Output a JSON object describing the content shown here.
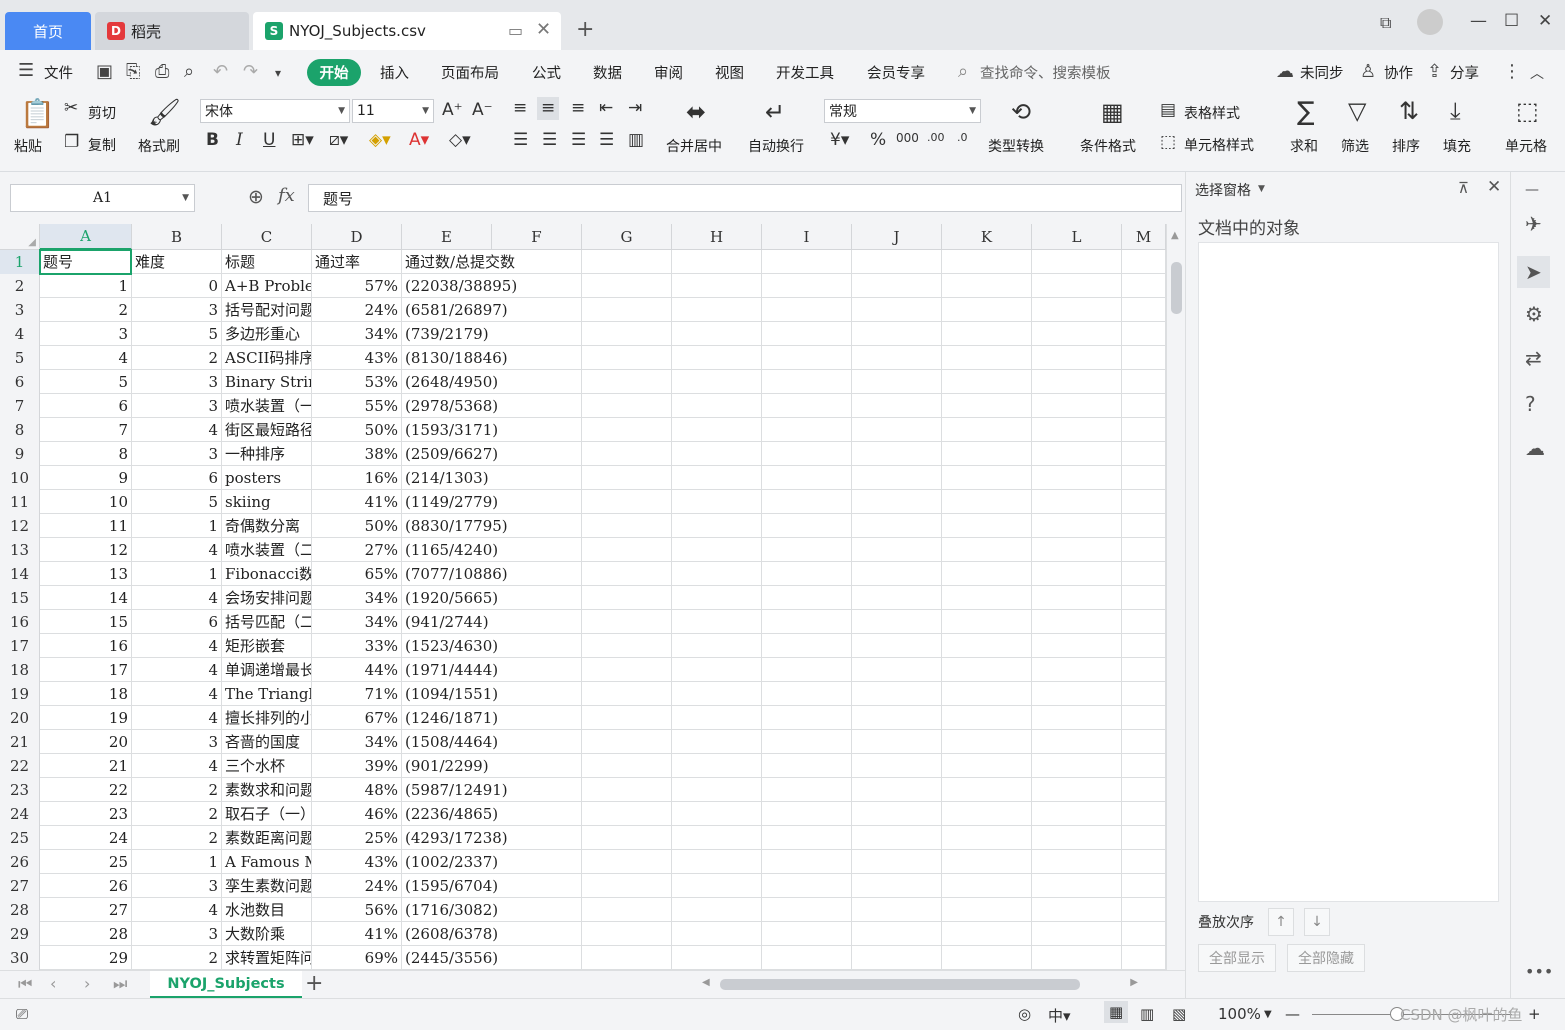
{
  "tabs": {
    "home": "首页",
    "docer": "稻壳",
    "document": "NYOJ_Subjects.csv"
  },
  "menu": {
    "file": "文件",
    "start": "开始",
    "items": [
      "插入",
      "页面布局",
      "公式",
      "数据",
      "审阅",
      "视图",
      "开发工具",
      "会员专享"
    ],
    "search": "查找命令、搜索模板",
    "sync": "未同步",
    "collab": "协作",
    "share": "分享"
  },
  "ribbon": {
    "paste": "粘贴",
    "cut": "剪切",
    "copy": "复制",
    "format_painter": "格式刷",
    "font_name": "宋体",
    "font_size": "11",
    "merge_center": "合并居中",
    "wrap_text": "自动换行",
    "number_format": "常规",
    "type_convert": "类型转换",
    "conditional_format": "条件格式",
    "table_style": "表格样式",
    "cell_style": "单元格样式",
    "sum": "求和",
    "filter": "筛选",
    "sort": "排序",
    "fill": "填充",
    "cell": "单元格"
  },
  "formula_bar": {
    "name_box": "A1",
    "fx": "fx",
    "content": "题号"
  },
  "columns": [
    "A",
    "B",
    "C",
    "D",
    "E",
    "F",
    "G",
    "H",
    "I",
    "J",
    "K",
    "L",
    "M"
  ],
  "header_row": [
    "题号",
    "难度",
    "标题",
    "通过率",
    "通过数/总提交数"
  ],
  "rows": [
    [
      "1",
      "0",
      "A+B Problem",
      "57%",
      "(22038/38895)"
    ],
    [
      "2",
      "3",
      "括号配对问题",
      "24%",
      "(6581/26897)"
    ],
    [
      "3",
      "5",
      "多边形重心",
      "34%",
      "(739/2179)"
    ],
    [
      "4",
      "2",
      "ASCII码排序",
      "43%",
      "(8130/18846)"
    ],
    [
      "5",
      "3",
      "Binary String",
      "53%",
      "(2648/4950)"
    ],
    [
      "6",
      "3",
      "喷水装置（一）",
      "55%",
      "(2978/5368)"
    ],
    [
      "7",
      "4",
      "街区最短路径",
      "50%",
      "(1593/3171)"
    ],
    [
      "8",
      "3",
      "一种排序",
      "38%",
      "(2509/6627)"
    ],
    [
      "9",
      "6",
      "posters",
      "16%",
      "(214/1303)"
    ],
    [
      "10",
      "5",
      "skiing",
      "41%",
      "(1149/2779)"
    ],
    [
      "11",
      "1",
      "奇偶数分离",
      "50%",
      "(8830/17795)"
    ],
    [
      "12",
      "4",
      "喷水装置（二）",
      "27%",
      "(1165/4240)"
    ],
    [
      "13",
      "1",
      "Fibonacci数",
      "65%",
      "(7077/10886)"
    ],
    [
      "14",
      "4",
      "会场安排问题",
      "34%",
      "(1920/5665)"
    ],
    [
      "15",
      "6",
      "括号匹配（二）",
      "34%",
      "(941/2744)"
    ],
    [
      "16",
      "4",
      "矩形嵌套",
      "33%",
      "(1523/4630)"
    ],
    [
      "17",
      "4",
      "单调递增最长子序列",
      "44%",
      "(1971/4444)"
    ],
    [
      "18",
      "4",
      "The Triangle",
      "71%",
      "(1094/1551)"
    ],
    [
      "19",
      "4",
      "擅长排列的小明",
      "67%",
      "(1246/1871)"
    ],
    [
      "20",
      "3",
      "吝啬的国度",
      "34%",
      "(1508/4464)"
    ],
    [
      "21",
      "4",
      "三个水杯",
      "39%",
      "(901/2299)"
    ],
    [
      "22",
      "2",
      "素数求和问题",
      "48%",
      "(5987/12491)"
    ],
    [
      "23",
      "2",
      "取石子（一）",
      "46%",
      "(2236/4865)"
    ],
    [
      "24",
      "2",
      "素数距离问题",
      "25%",
      "(4293/17238)"
    ],
    [
      "25",
      "1",
      "A Famous Music Composer",
      "43%",
      "(1002/2337)"
    ],
    [
      "26",
      "3",
      "孪生素数问题",
      "24%",
      "(1595/6704)"
    ],
    [
      "27",
      "4",
      "水池数目",
      "56%",
      "(1716/3082)"
    ],
    [
      "28",
      "3",
      "大数阶乘",
      "41%",
      "(2608/6378)"
    ],
    [
      "29",
      "2",
      "求转置矩阵问题",
      "69%",
      "(2445/3556)"
    ]
  ],
  "sheet_tab": "NYOJ_Subjects",
  "pane": {
    "title": "选择窗格",
    "subtitle": "文档中的对象",
    "stack_order": "叠放次序",
    "show_all": "全部显示",
    "hide_all": "全部隐藏"
  },
  "status": {
    "zoom": "100%",
    "watermark": "CSDN @枫叶的鱼"
  },
  "colors": {
    "accent": "#1ba36b",
    "home_tab": "#4a89f3"
  }
}
